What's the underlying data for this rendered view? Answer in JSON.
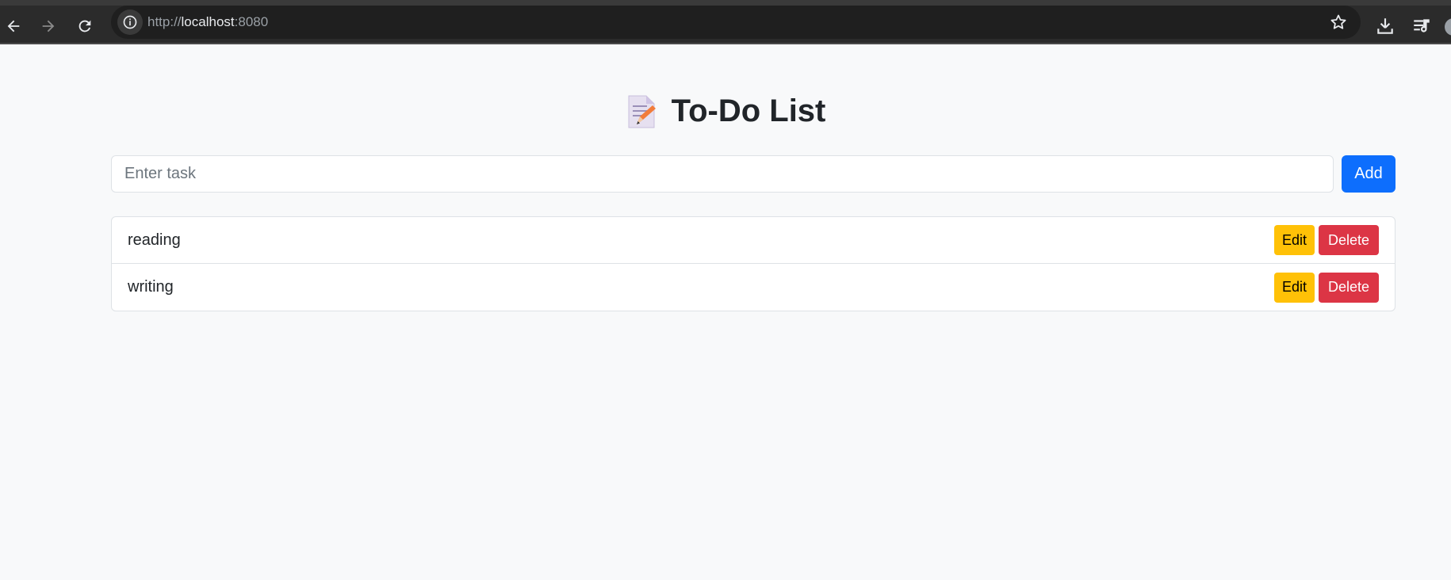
{
  "browser": {
    "url_prefix": "http://",
    "url_host": "localhost",
    "url_port": ":8080",
    "icons": [
      "back-icon",
      "forward-icon",
      "reload-icon",
      "site-info-icon",
      "bookmark-star-icon",
      "download-icon",
      "reading-list-icon",
      "profile-avatar"
    ]
  },
  "app": {
    "title": "To-Do List",
    "title_icon": "memo-icon"
  },
  "form": {
    "placeholder": "Enter task",
    "value": "",
    "add_label": "Add"
  },
  "tasks": [
    {
      "text": "reading",
      "edit_label": "Edit",
      "delete_label": "Delete"
    },
    {
      "text": "writing",
      "edit_label": "Edit",
      "delete_label": "Delete"
    }
  ],
  "colors": {
    "primary": "#0d6efd",
    "warning": "#ffc107",
    "danger": "#dc3545",
    "background": "#f8f9fa"
  }
}
